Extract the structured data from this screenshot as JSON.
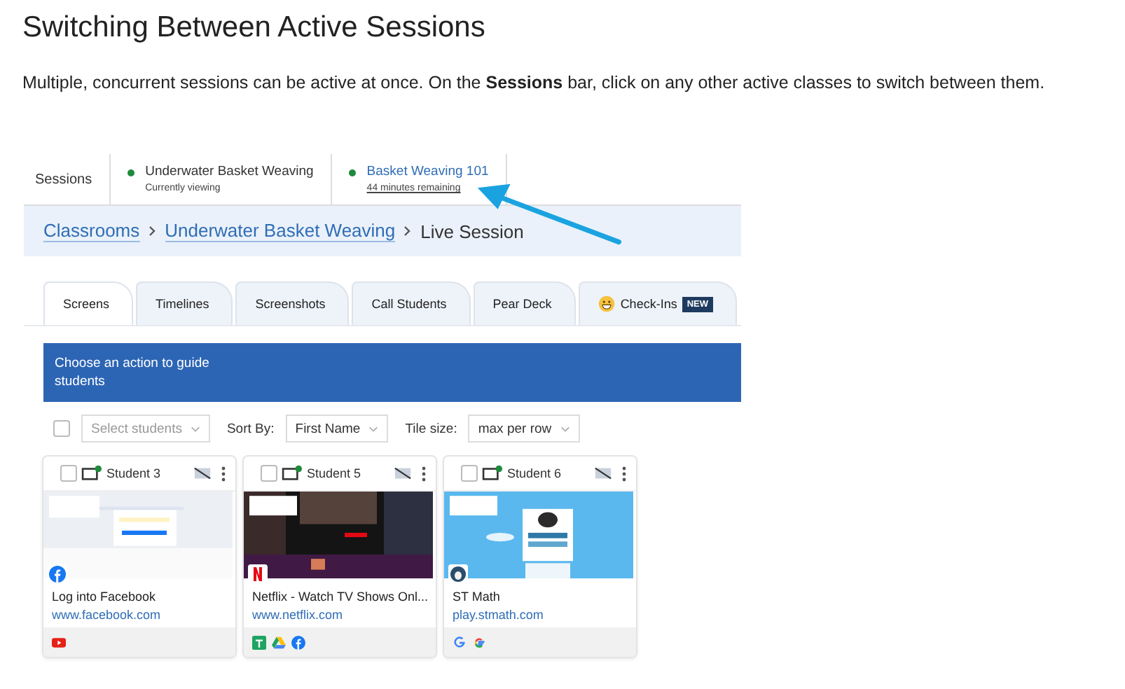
{
  "title": "Switching Between Active Sessions",
  "intro": "Multiple, concurrent sessions can be active at once. On the **Sessions** bar, click on any other active classes to switch between them.",
  "screenshot": {
    "sessions_bar": {
      "label": "Sessions",
      "sessions": [
        {
          "name": "Underwater Basket Weaving",
          "status": "Currently viewing",
          "current": true
        },
        {
          "name": "Basket Weaving 101",
          "status": "44 minutes remaining",
          "current": false
        }
      ]
    },
    "breadcrumb": [
      {
        "label": "Classrooms",
        "link": true
      },
      {
        "label": "Underwater Basket Weaving",
        "link": true
      },
      {
        "label": "Live Session",
        "link": false
      }
    ],
    "tabs": [
      {
        "label": "Screens",
        "selected": true
      },
      {
        "label": "Timelines",
        "selected": false
      },
      {
        "label": "Screenshots",
        "selected": false
      },
      {
        "label": "Call Students",
        "selected": false
      },
      {
        "label": "Pear Deck",
        "selected": false
      },
      {
        "label": "Check-Ins",
        "selected": false,
        "badge": "NEW",
        "kind": "emoji"
      }
    ],
    "banner": "Choose an action to guide students",
    "toolbar": {
      "select_all_checked": false,
      "select_placeholder": "Select students",
      "sort_label": "Sort By:",
      "sort_value": "First Name",
      "size_label": "Tile size:",
      "size_value": "max per row"
    },
    "students": [
      {
        "name": "Student 3",
        "checked": false,
        "kind": "facebook",
        "page_title": "Log into Facebook",
        "url": "www.facebook.com",
        "tabs": [
          {
            "kind": "youtube"
          }
        ]
      },
      {
        "name": "Student 5",
        "checked": false,
        "kind": "netflix",
        "page_title": "Netflix - Watch TV Shows Onl...",
        "url": "www.netflix.com",
        "tabs": [
          {
            "kind": "sheets"
          },
          {
            "kind": "drive"
          },
          {
            "kind": "facebook"
          }
        ]
      },
      {
        "name": "Student 6",
        "checked": false,
        "kind": "stmath",
        "page_title": "ST Math",
        "url": "play.stmath.com",
        "tabs": [
          {
            "kind": "google"
          },
          {
            "kind": "google-color"
          }
        ]
      }
    ]
  }
}
